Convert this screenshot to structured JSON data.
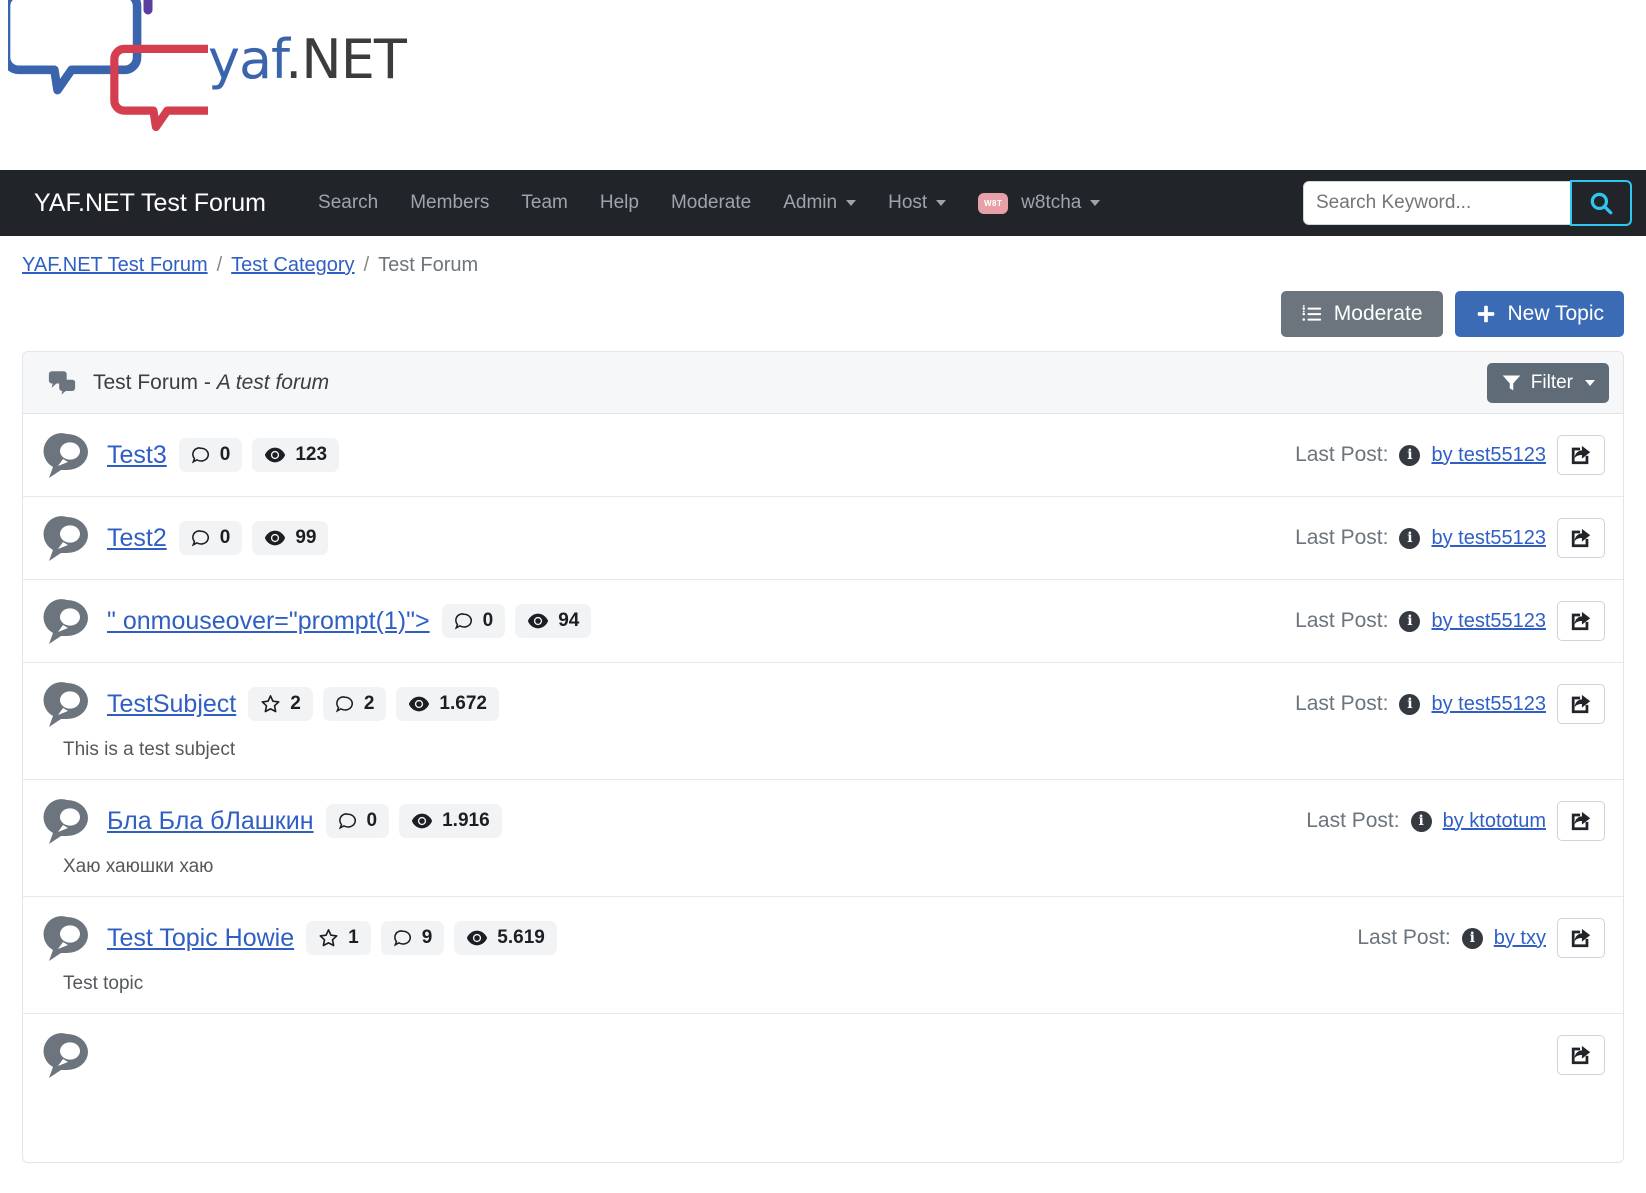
{
  "logo": {
    "text_primary": "yaf",
    "text_secondary": ".NET",
    "alt": "yaf.NET logo",
    "colors": {
      "blue": "#3a64ab",
      "red": "#d43f4f",
      "purple": "#5b3fa0",
      "dark": "#3c3c3c"
    }
  },
  "navbar": {
    "brand": "YAF.NET Test Forum",
    "background": "#212529",
    "links": [
      {
        "label": "Search",
        "has_caret": false
      },
      {
        "label": "Members",
        "has_caret": false
      },
      {
        "label": "Team",
        "has_caret": false
      },
      {
        "label": "Help",
        "has_caret": false
      },
      {
        "label": "Moderate",
        "has_caret": false
      },
      {
        "label": "Admin",
        "has_caret": true
      },
      {
        "label": "Host",
        "has_caret": true
      }
    ],
    "user": {
      "name": "w8tcha",
      "avatar_initials": "W8T",
      "avatar_color": "#e8a0a8",
      "has_caret": true
    },
    "search": {
      "placeholder": "Search Keyword...",
      "value": "",
      "button_icon": "search-icon",
      "accent": "#2ec8ef"
    }
  },
  "breadcrumb": {
    "items": [
      {
        "label": "YAF.NET Test Forum",
        "link": true
      },
      {
        "label": "Test Category",
        "link": true
      },
      {
        "label": "Test Forum",
        "link": false
      }
    ],
    "separator": "/"
  },
  "actions": {
    "moderate": {
      "label": "Moderate",
      "icon": "task-list-icon",
      "color": "#6c757d"
    },
    "new_topic": {
      "label": "New Topic",
      "icon": "plus-icon",
      "color": "#3b6bb5"
    }
  },
  "forum_card": {
    "icon": "comments-icon",
    "title": "Test Forum",
    "dash": " - ",
    "description": "A test forum",
    "filter": {
      "label": "Filter",
      "icon": "funnel-icon",
      "caret": true,
      "color": "#5f6b76"
    }
  },
  "labels": {
    "last_post": "Last Post:",
    "share_icon": "share-icon",
    "info_icon": "info-icon"
  },
  "topics": [
    {
      "title": "Test3",
      "icon": "topic-comment-icon",
      "stars": null,
      "replies": "0",
      "views": "123",
      "description": null,
      "last_post_by": "by test55123"
    },
    {
      "title": "Test2",
      "icon": "topic-comment-icon",
      "stars": null,
      "replies": "0",
      "views": "99",
      "description": null,
      "last_post_by": "by test55123"
    },
    {
      "title": "\" onmouseover=\"prompt(1)\">",
      "icon": "topic-comment-icon",
      "stars": null,
      "replies": "0",
      "views": "94",
      "description": null,
      "last_post_by": "by test55123"
    },
    {
      "title": "TestSubject",
      "icon": "topic-comment-icon",
      "stars": "2",
      "replies": "2",
      "views": "1.672",
      "description": "This is a test subject",
      "last_post_by": "by test55123"
    },
    {
      "title": "Бла Бла бЛашкин",
      "icon": "topic-comment-icon",
      "stars": null,
      "replies": "0",
      "views": "1.916",
      "description": "Хаю хаюшки хаю",
      "last_post_by": "by ktototum"
    },
    {
      "title": "Test Topic Howie",
      "icon": "topic-comment-icon",
      "stars": "1",
      "replies": "9",
      "views": "5.619",
      "description": "Test topic",
      "last_post_by": "by txy"
    }
  ]
}
